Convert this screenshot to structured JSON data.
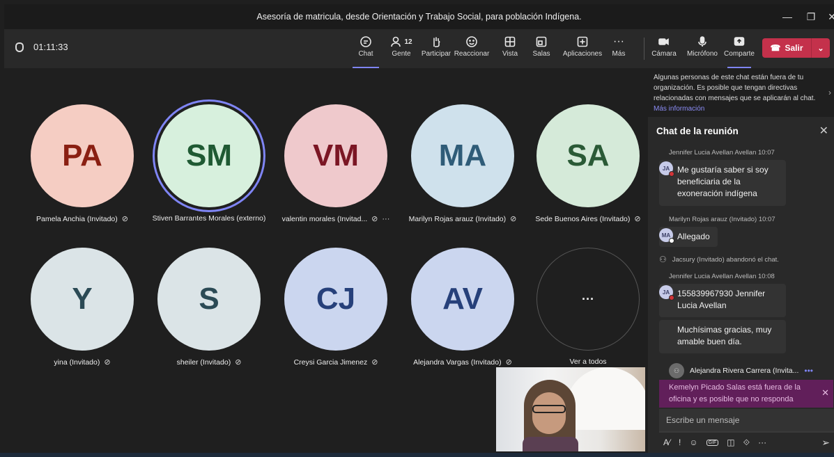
{
  "window": {
    "title": "Asesoría de matricula, desde Orientación y Trabajo Social, para población Indígena."
  },
  "toolbar": {
    "timer": "01:11:33",
    "chat_label": "Chat",
    "people_label": "Gente",
    "people_count": "12",
    "raise_label": "Participar",
    "react_label": "Reaccionar",
    "view_label": "Vista",
    "rooms_label": "Salas",
    "apps_label": "Aplicaciones",
    "more_label": "Más",
    "camera_label": "Cámara",
    "mic_label": "Micrófono",
    "share_label": "Comparte",
    "leave_label": "Salir"
  },
  "participants": [
    {
      "initials": "PA",
      "name": "Pamela Anchia (Invitado)",
      "bg": "#f5cdc3",
      "fg": "#8a1f12"
    },
    {
      "initials": "SM",
      "name": "Stiven Barrantes Morales (externo)",
      "bg": "#d7f0dd",
      "fg": "#1f5a33"
    },
    {
      "initials": "VM",
      "name": "valentin morales (Invitad...",
      "bg": "#efc9cc",
      "fg": "#7b1624"
    },
    {
      "initials": "MA",
      "name": "Marilyn Rojas arauz (Invitado)",
      "bg": "#cfe1ec",
      "fg": "#2f5c78"
    },
    {
      "initials": "SA",
      "name": "Sede Buenos Aires (Invitado)",
      "bg": "#d5ead9",
      "fg": "#2a5a36"
    },
    {
      "initials": "Y",
      "name": "yina (Invitado)",
      "bg": "#dbe4e7",
      "fg": "#2b4a55"
    },
    {
      "initials": "S",
      "name": "sheiler (Invitado)",
      "bg": "#dbe4e7",
      "fg": "#2b4a55"
    },
    {
      "initials": "CJ",
      "name": "Creysi Garcia Jimenez",
      "bg": "#cbd6ef",
      "fg": "#26407a"
    },
    {
      "initials": "AV",
      "name": "Alejandra Vargas (Invitado)",
      "bg": "#cbd6ef",
      "fg": "#26407a"
    }
  ],
  "see_all": {
    "label": "Ver a todos",
    "dots": "···"
  },
  "chat": {
    "notice": "Algunas personas de este chat están fuera de tu organización. Es posible que tengan directivas relacionadas con mensajes que se aplicarán al chat.",
    "notice_link": "Más información",
    "title": "Chat de la reunión",
    "msg1_sender": "Jennifer Lucia Avellan Avellan  10:07",
    "msg1_initials": "JA",
    "msg1_text": "Me gustaría saber si soy beneficiaria de la exoneración indígena",
    "msg2_sender": "Marilyn Rojas arauz (Invitado)  10:07",
    "msg2_initials": "MA",
    "msg2_text": "Allegado",
    "system_text": "Jacsury (Invitado) abandonó el chat.",
    "msg3_sender": "Jennifer Lucia Avellan Avellan  10:08",
    "msg3_initials": "JA",
    "msg3_text": "155839967930 Jennifer Lucia Avellan",
    "msg4_text": "Muchísimas gracias, muy amable buen día.",
    "typing_name": "Alejandra Rivera Carrera (Invita...",
    "oof_text": "Kemelyn Picado Salas está fuera de la oficina y es posible que no responda",
    "compose_placeholder": "Escribe un mensaje",
    "gif_label": "GIF"
  }
}
